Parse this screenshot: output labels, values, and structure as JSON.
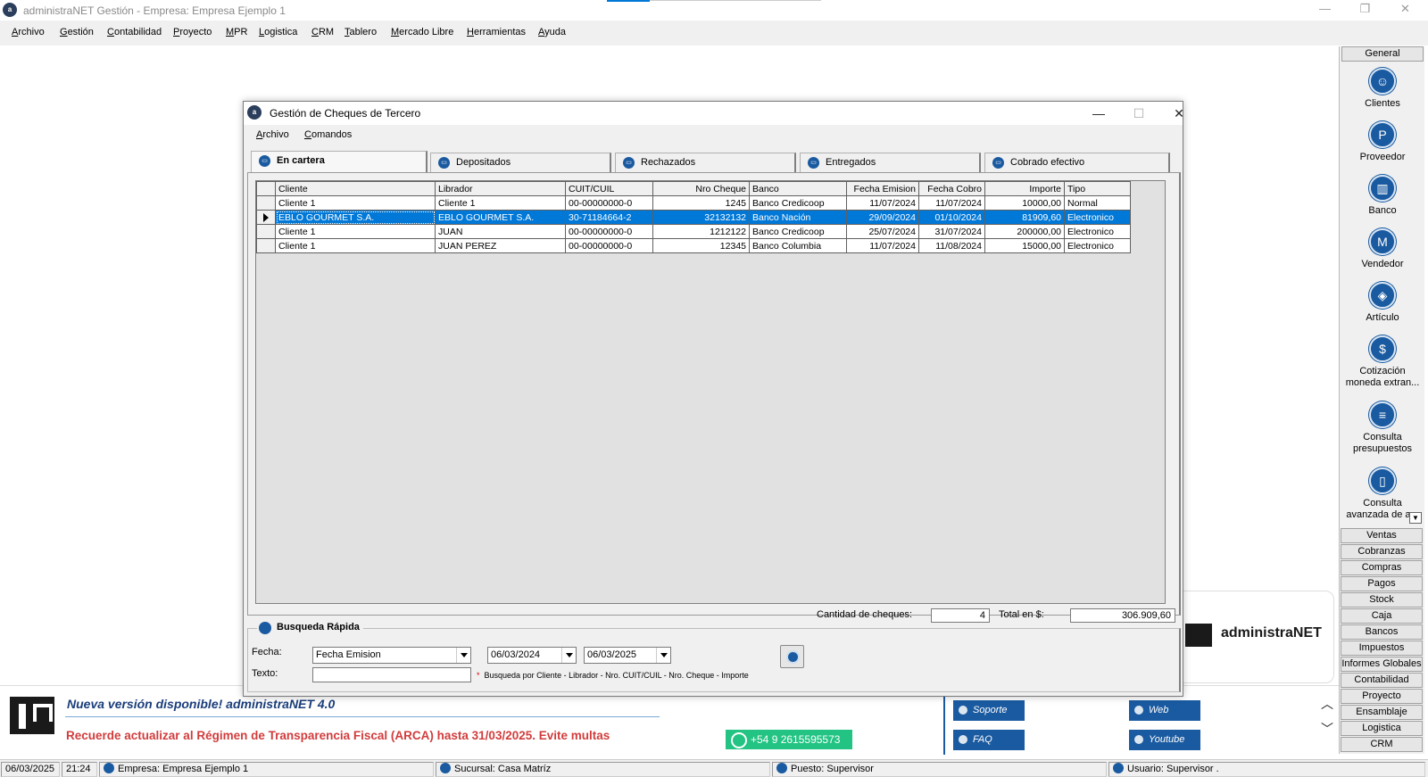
{
  "window": {
    "title": "administraNET Gestión - Empresa: Empresa Ejemplo 1"
  },
  "menubar": [
    "Archivo",
    "Gestión",
    "Contabilidad",
    "Proyecto",
    "MPR",
    "Logistica",
    "CRM",
    "Tablero",
    "Mercado Libre",
    "Herramientas",
    "Ayuda"
  ],
  "sidebar": {
    "header": "General",
    "items": [
      {
        "label": "Clientes",
        "icon": "clients-icon"
      },
      {
        "label": "Proveedor",
        "icon": "supplier-icon"
      },
      {
        "label": "Banco",
        "icon": "bank-icon"
      },
      {
        "label": "Vendedor",
        "icon": "seller-icon"
      },
      {
        "label": "Artículo",
        "icon": "box-icon"
      },
      {
        "label": "Cotización moneda extran...",
        "icon": "currency-icon"
      },
      {
        "label": "Consulta presupuestos",
        "icon": "document-icon"
      },
      {
        "label": "Consulta avanzada de a...",
        "icon": "tablet-icon"
      }
    ],
    "buttons": [
      "Ventas",
      "Cobranzas",
      "Compras",
      "Pagos",
      "Stock",
      "Caja",
      "Bancos",
      "Impuestos",
      "Informes Globales",
      "Contabilidad",
      "Proyecto",
      "Ensamblaje",
      "Logistica",
      "CRM"
    ]
  },
  "logo_panel": {
    "text": "administraNET"
  },
  "dialog": {
    "title": "Gestión de Cheques de Tercero",
    "menu": [
      "Archivo",
      "Comandos"
    ],
    "tabs": [
      "En cartera",
      "Depositados",
      "Rechazados",
      "Entregados",
      "Cobrado efectivo"
    ],
    "grid": {
      "columns": [
        "Cliente",
        "Librador",
        "CUIT/CUIL",
        "Nro Cheque",
        "Banco",
        "Fecha Emision",
        "Fecha Cobro",
        "Importe",
        "Tipo"
      ],
      "rows": [
        [
          "Cliente 1",
          "Cliente 1",
          "00-00000000-0",
          "1245",
          "Banco Credicoop",
          "11/07/2024",
          "11/07/2024",
          "10000,00",
          "Normal"
        ],
        [
          "EBLO GOURMET S.A.",
          "EBLO GOURMET S.A.",
          "30-71184664-2",
          "32132132",
          "Banco Nación",
          "29/09/2024",
          "01/10/2024",
          "81909,60",
          "Electronico"
        ],
        [
          "Cliente 1",
          "JUAN",
          "00-00000000-0",
          "1212122",
          "Banco Credicoop",
          "25/07/2024",
          "31/07/2024",
          "200000,00",
          "Electronico"
        ],
        [
          "Cliente 1",
          "JUAN PEREZ",
          "00-00000000-0",
          "12345",
          "Banco Columbia",
          "11/07/2024",
          "11/08/2024",
          "15000,00",
          "Electronico"
        ]
      ],
      "selected_row": 1
    },
    "totals": {
      "count_label": "Cantidad de cheques:",
      "count_value": "4",
      "total_label": "Total en $:",
      "total_value": "306.909,60"
    },
    "quick_search": {
      "title": "Busqueda Rápida",
      "fecha_label": "Fecha:",
      "fecha_type": "Fecha Emision",
      "date_from": "06/03/2024",
      "date_to": "06/03/2025",
      "texto_label": "Texto:",
      "texto_value": "",
      "hint": "Busqueda por Cliente -  Librador - Nro. CUIT/CUIL - Nro. Cheque - Importe"
    }
  },
  "banner": {
    "news": "Nueva versión disponible! administraNET 4.0",
    "warning": "Recuerde actualizar al Régimen de Transparencia Fiscal (ARCA) hasta 31/03/2025. Evite multas",
    "whatsapp": "+54 9 2615595573",
    "links": [
      "Soporte",
      "Web",
      "FAQ",
      "Youtube"
    ]
  },
  "statusbar": {
    "date": "06/03/2025",
    "time": "21:24",
    "empresa": "Empresa: Empresa Ejemplo 1",
    "sucursal": "Sucursal: Casa Matríz",
    "puesto": "Puesto: Supervisor",
    "usuario": "Usuario: Supervisor ."
  },
  "colors": {
    "selection": "#0078d7",
    "brand": "#1a5aa0",
    "warning": "#d23c3c",
    "whatsapp": "#23c483"
  }
}
